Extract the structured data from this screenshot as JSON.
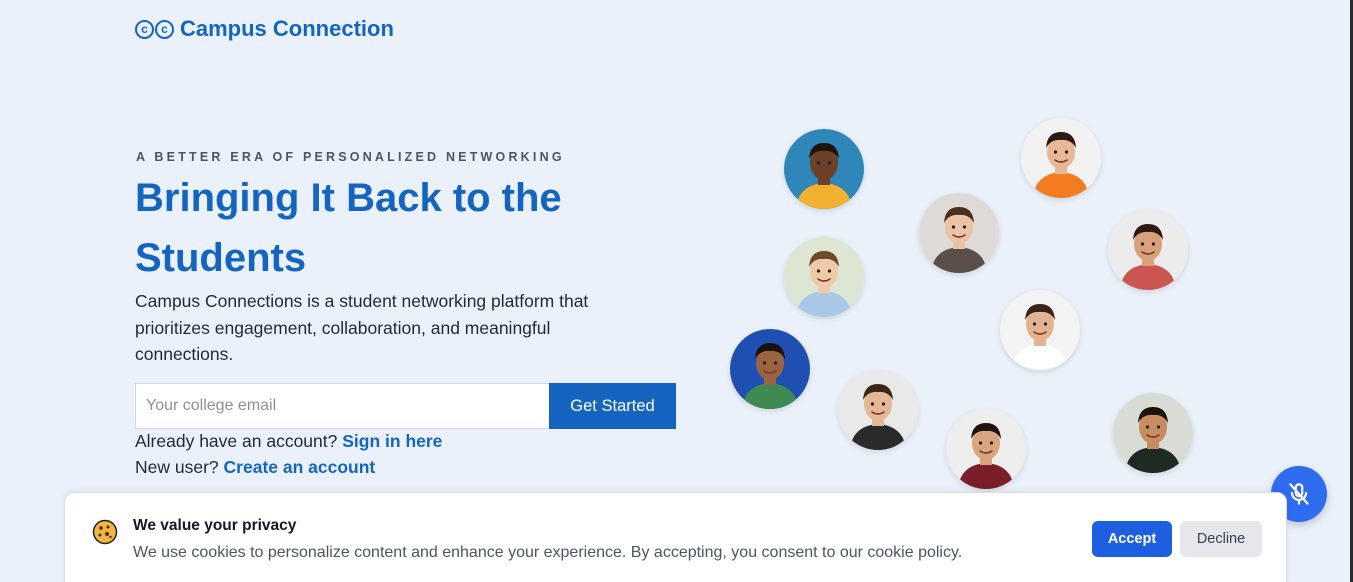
{
  "brand": {
    "mark": "©©",
    "name": "Campus Connection"
  },
  "hero": {
    "eyebrow": "A BETTER ERA OF PERSONALIZED NETWORKING",
    "headline": "Bringing It Back to the Students",
    "description": "Campus Connections is a student networking platform that prioritizes engagement, collaboration, and meaningful connections."
  },
  "signup": {
    "email_placeholder": "Your college email",
    "email_value": "",
    "cta_label": "Get Started"
  },
  "account_links": {
    "existing_prefix": "Already have an account?",
    "sign_in_label": "Sign in here",
    "new_prefix": "New user?",
    "create_label": "Create an account"
  },
  "avatars": [
    {
      "icon": "student-avatar-1",
      "bg": "#2f86b8",
      "skin": "#6b4229",
      "shirt": "#f0b030",
      "hair": "#1b120c"
    },
    {
      "icon": "student-avatar-2",
      "bg": "#f2f2f2",
      "skin": "#e8b896",
      "shirt": "#f47c20",
      "hair": "#2a1a12"
    },
    {
      "icon": "student-avatar-3",
      "bg": "#dedad7",
      "skin": "#eac3a7",
      "shirt": "#5b4f4a",
      "hair": "#4a2e1e"
    },
    {
      "icon": "student-avatar-4",
      "bg": "#ececec",
      "skin": "#d9a07c",
      "shirt": "#c9574f",
      "hair": "#2c1a10"
    },
    {
      "icon": "student-avatar-5",
      "bg": "#dce6d2",
      "skin": "#f0c8aa",
      "shirt": "#a9c8e8",
      "hair": "#6b4a2a"
    },
    {
      "icon": "student-avatar-6",
      "bg": "#f3f3f3",
      "skin": "#e2b392",
      "shirt": "#ffffff",
      "hair": "#3a2418"
    },
    {
      "icon": "student-avatar-7",
      "bg": "#1f4fb0",
      "skin": "#9a6440",
      "shirt": "#3e8a52",
      "hair": "#1a1210"
    },
    {
      "icon": "student-avatar-8",
      "bg": "#e9e9e9",
      "skin": "#e4b896",
      "shirt": "#2a2a2a",
      "hair": "#3c2616"
    },
    {
      "icon": "student-avatar-9",
      "bg": "#eeeeee",
      "skin": "#d9a480",
      "shirt": "#7a1e2a",
      "hair": "#1e140e"
    },
    {
      "icon": "student-avatar-10",
      "bg": "#d8dcd4",
      "skin": "#c88c62",
      "shirt": "#1f2a24",
      "hair": "#1a120c"
    }
  ],
  "cookie": {
    "title": "We value your privacy",
    "text": "We use cookies to personalize content and enhance your experience. By accepting, you consent to our cookie policy.",
    "accept_label": "Accept",
    "decline_label": "Decline"
  },
  "voice_button": {
    "icon": "microphone-off-icon"
  },
  "colors": {
    "brand": "#1565c0",
    "accent_button": "#1d5fe0",
    "page_bg": "#eaf1fb"
  }
}
